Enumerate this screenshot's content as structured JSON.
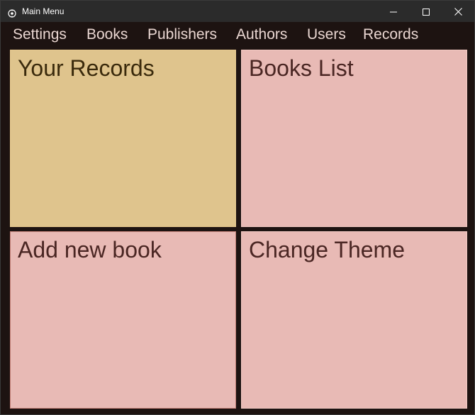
{
  "window": {
    "title": "Main Menu",
    "app_icon": "app-gear-icon",
    "controls": {
      "minimize_icon": "minimize-icon",
      "maximize_icon": "maximize-icon",
      "close_icon": "close-icon"
    }
  },
  "menu": {
    "items": [
      {
        "label": "Settings"
      },
      {
        "label": "Books"
      },
      {
        "label": "Publishers"
      },
      {
        "label": "Authors"
      },
      {
        "label": "Users"
      },
      {
        "label": "Records"
      }
    ]
  },
  "tiles": {
    "your_records": {
      "label": "Your Records",
      "bg": "#dfc48d",
      "fg": "#3a2a0c"
    },
    "books_list": {
      "label": "Books List",
      "bg": "#e8bab5",
      "fg": "#4a2623"
    },
    "add_new_book": {
      "label": "Add new book",
      "bg": "#e8bab5",
      "fg": "#4a2623"
    },
    "change_theme": {
      "label": "Change Theme",
      "bg": "#e8bab5",
      "fg": "#4a2623"
    }
  },
  "colors": {
    "window_bg": "#1d1311",
    "titlebar_bg": "#2b2b2b",
    "menu_text": "#ead7d2"
  }
}
